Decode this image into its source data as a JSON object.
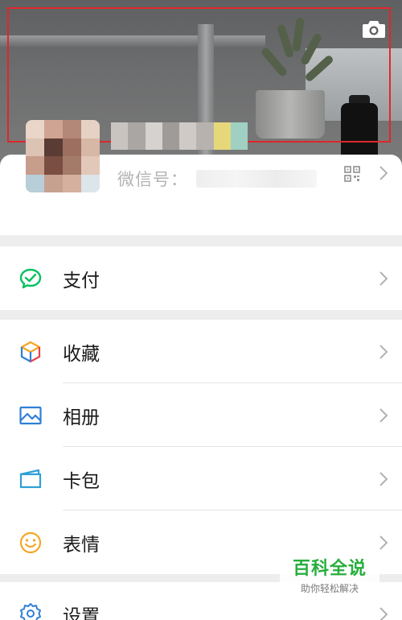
{
  "header": {
    "camera_icon": "camera-icon",
    "highlight_color": "#e0262b"
  },
  "profile": {
    "wxid_label": "微信号：",
    "wxid_value": "",
    "qr_icon": "qr-code-icon",
    "chevron_icon": "chevron-right-icon"
  },
  "menu": {
    "pay": {
      "label": "支付",
      "icon": "wechat-pay-icon",
      "color": "#07c160"
    },
    "favorites": {
      "label": "收藏",
      "icon": "cube-icon"
    },
    "album": {
      "label": "相册",
      "icon": "picture-icon",
      "color": "#2f7fd6"
    },
    "cards": {
      "label": "卡包",
      "icon": "card-icon",
      "color": "#2f9fd6"
    },
    "stickers": {
      "label": "表情",
      "icon": "smiley-icon",
      "color": "#f5a623"
    },
    "settings": {
      "label": "设置",
      "icon": "gear-icon",
      "color": "#2f7fd6"
    }
  },
  "watermark": {
    "title": "百科全说",
    "subtitle": "助你轻松解决",
    "color": "#27ae3c"
  }
}
